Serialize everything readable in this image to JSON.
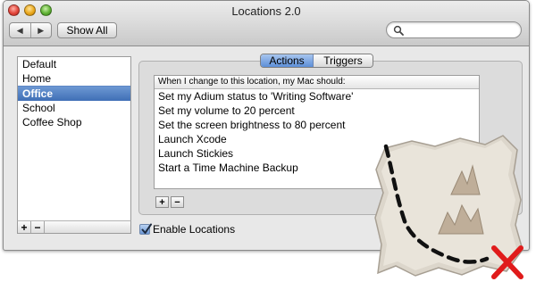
{
  "window": {
    "title": "Locations 2.0"
  },
  "toolbar": {
    "show_all_label": "Show All",
    "back_icon": "back-icon",
    "forward_icon": "forward-icon",
    "search": {
      "value": "",
      "placeholder": "",
      "icon": "search-icon"
    }
  },
  "sidebar": {
    "items": [
      {
        "label": "Default",
        "selected": false
      },
      {
        "label": "Home",
        "selected": false
      },
      {
        "label": "Office",
        "selected": true
      },
      {
        "label": "School",
        "selected": false
      },
      {
        "label": "Coffee Shop",
        "selected": false
      }
    ],
    "add_label": "+",
    "remove_label": "−"
  },
  "tabs": [
    {
      "label": "Actions",
      "selected": true
    },
    {
      "label": "Triggers",
      "selected": false
    }
  ],
  "actions": {
    "header": "When I change to this location, my Mac should:",
    "rows": [
      "Set my Adium status to 'Writing Software'",
      "Set my volume to 20 percent",
      "Set the screen brightness to 80 percent",
      "Launch Xcode",
      "Launch Stickies",
      "Start a Time Machine Backup"
    ],
    "add_label": "+",
    "remove_label": "−"
  },
  "enable_locations": {
    "label": "Enable Locations",
    "checked": true
  },
  "colors": {
    "selection": "#3f6fb6",
    "map_paper": "#dcd6cb",
    "x_mark": "#e01b1b"
  }
}
